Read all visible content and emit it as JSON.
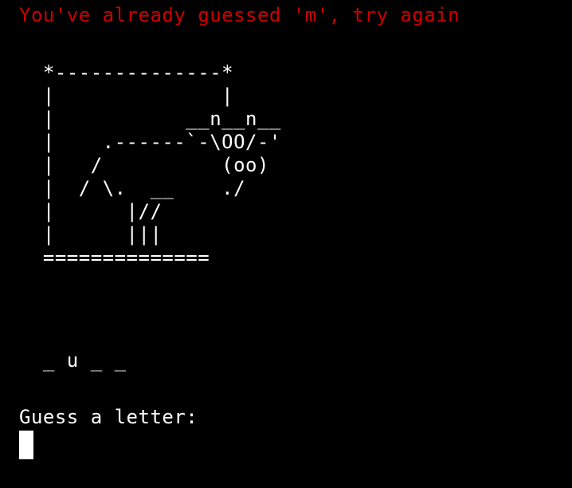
{
  "terminal": {
    "error_message": "You've already guessed 'm', try again",
    "gallows_art": "  *--------------*\n  |              |\n  |           __n__n__\n  |    .------`-\\OO/-'\n  |   /          (oo)\n  |  / \\.  __    ./\n  |      |//\n  |      |||\n  ==============",
    "word_display": "  _ u _ _",
    "prompt": "Guess a letter:",
    "colors": {
      "background": "#000000",
      "text": "#ffffff",
      "error": "#cc0000"
    }
  }
}
